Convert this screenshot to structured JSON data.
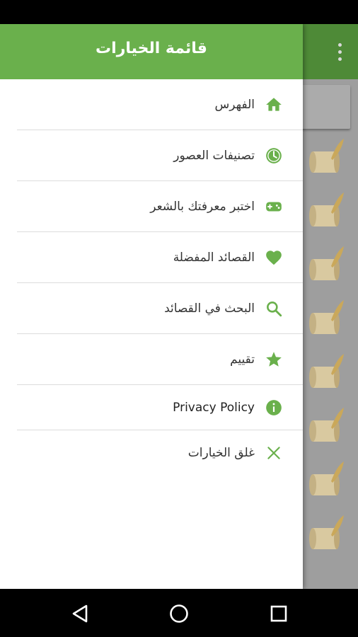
{
  "drawer": {
    "title": "قائمة الخيارات",
    "accent_color": "#6ab04c",
    "items": [
      {
        "label": "الفهرس",
        "icon": "home-icon"
      },
      {
        "label": "تصنيفات العصور",
        "icon": "clock-icon"
      },
      {
        "label": "اختبر معرفتك بالشعر",
        "icon": "gamepad-icon"
      },
      {
        "label": "القصائد المفضلة",
        "icon": "heart-icon"
      },
      {
        "label": "البحث في القصائد",
        "icon": "search-icon"
      },
      {
        "label": "تقييم",
        "icon": "star-icon"
      },
      {
        "label": "Privacy Policy",
        "icon": "info-icon"
      },
      {
        "label": "غلق الخيارات",
        "icon": "close-icon"
      }
    ]
  },
  "background": {
    "overflow_icon": "more-vert-icon",
    "list_item_icon": "scroll-quill-icon"
  },
  "navigation": {
    "back": "back-icon",
    "home": "home-circle-icon",
    "recents": "recents-icon"
  }
}
